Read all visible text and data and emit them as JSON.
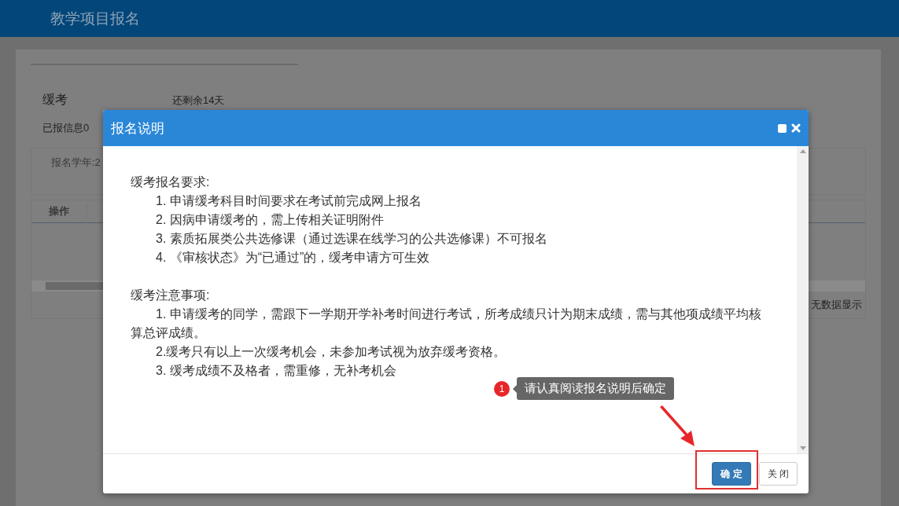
{
  "header": {
    "title": "教学项目报名"
  },
  "background": {
    "section_title": "缓考",
    "remaining": "还剩余14天",
    "reported": "已报信息0",
    "filter_label": "报名学年:2",
    "table": {
      "columns": [
        "操作"
      ],
      "empty_text": "无数据显示"
    }
  },
  "dialog": {
    "title": "报名说明",
    "sections": [
      {
        "heading": "缓考报名要求:",
        "items": [
          "1. 申请缓考科目时间要求在考试前完成网上报名",
          "2. 因病申请缓考的，需上传相关证明附件",
          "3. 素质拓展类公共选修课（通过选课在线学习的公共选修课）不可报名",
          "4. 《审核状态》为“已通过”的，缓考申请方可生效"
        ]
      },
      {
        "heading": "缓考注意事项:",
        "items": [
          "1. 申请缓考的同学，需跟下一学期开学补考时间进行考试，所考成绩只计为期末成绩，需与其他项成绩平均核算总评成绩。",
          "2.缓考只有以上一次缓考机会，未参加考试视为放弃缓考资格。",
          "3. 缓考成绩不及格者，需重修，无补考机会"
        ]
      }
    ],
    "buttons": [
      {
        "label": "确 定",
        "kind": "primary"
      },
      {
        "label": "关 闭",
        "kind": "default"
      }
    ]
  },
  "annotation": {
    "badge": "1",
    "tooltip": "请认真阅读报名说明后确定"
  }
}
